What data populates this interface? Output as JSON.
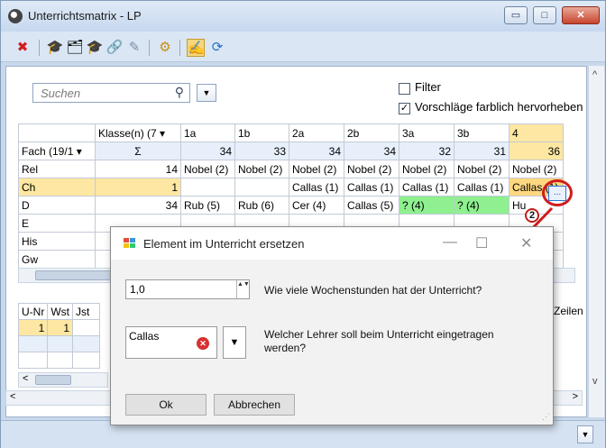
{
  "window": {
    "title": "Unterrichtsmatrix - LP",
    "btn_minimize": "▭",
    "btn_maximize": "□",
    "btn_close": "✕"
  },
  "toolbar": {
    "icons": [
      "delete-icon",
      "teacher-hat-icon",
      "class-icon",
      "teacher-icon",
      "link-icon",
      "clear-icon",
      "settings-icon",
      "edit-icon",
      "refresh-icon"
    ],
    "glyphs": [
      "✖",
      "🎓",
      "🗂",
      "🎓",
      "🔗",
      "✎",
      "⚙",
      "✍",
      "⟳"
    ]
  },
  "search": {
    "placeholder": "Suchen",
    "mag": "⚲",
    "dd": "▼"
  },
  "filters": {
    "filter_label": "Filter",
    "filter_checked": false,
    "highlight_label": "Vorschläge farblich hervorheben",
    "highlight_checked": true,
    "check_mark": "✓"
  },
  "matrix": {
    "header": [
      "",
      "Klasse(n) (7",
      "1a",
      "1b",
      "2a",
      "2b",
      "3a",
      "3b",
      "4"
    ],
    "sum_row": [
      "Fach (19/1",
      "Σ",
      "34",
      "33",
      "34",
      "34",
      "32",
      "31",
      "36"
    ],
    "rows": [
      [
        "Rel",
        "14",
        "Nobel (2)",
        "Nobel (2)",
        "Nobel (2)",
        "Nobel (2)",
        "Nobel (2)",
        "Nobel (2)",
        "Nobel (2)"
      ],
      [
        "Ch",
        "1",
        "",
        "",
        "Callas (1)",
        "Callas (1)",
        "Callas (1)",
        "Callas (1)",
        "Callas (1)"
      ],
      [
        "D",
        "34",
        "Rub (5)",
        "Rub (6)",
        "Cer (4)",
        "Callas (5)",
        "? (4)",
        "? (4)",
        "Hu"
      ],
      [
        "E",
        "",
        "",
        "",
        "",
        "",
        "",
        "",
        ""
      ],
      [
        "His",
        "",
        "",
        "",
        "",
        "",
        "",
        "",
        ""
      ],
      [
        "Gw",
        "",
        "",
        "",
        "",
        "",
        "",
        "",
        ""
      ]
    ],
    "dropdown_glyph": "▾"
  },
  "lower_table": {
    "header": [
      "U-Nr",
      "Wst",
      "Jst"
    ],
    "row1": [
      "1",
      "1",
      ""
    ],
    "right_header": "Zeilen"
  },
  "annotation": {
    "dots": "...",
    "badge": "2"
  },
  "dialog": {
    "title": "Element im Unterricht ersetzen",
    "minimize": "—",
    "maximize": "☐",
    "close": "✕",
    "hours_value": "1,0",
    "hours_question": "Wie viele Wochenstunden hat der Unterricht?",
    "teacher_value": "Callas",
    "teacher_question": "Welcher Lehrer soll beim Unterricht eingetragen werden?",
    "ok_label": "Ok",
    "cancel_label": "Abbrechen",
    "spin_glyph": "▲▼",
    "dd": "▼",
    "clear": "✕"
  },
  "scroll": {
    "up": "^",
    "down": "v",
    "left": "<",
    "right": ">"
  },
  "colors": {
    "highlight_green": "#8ef08e",
    "selected_yellow": "#fde7a2",
    "annotation_red": "#d11c1c"
  }
}
